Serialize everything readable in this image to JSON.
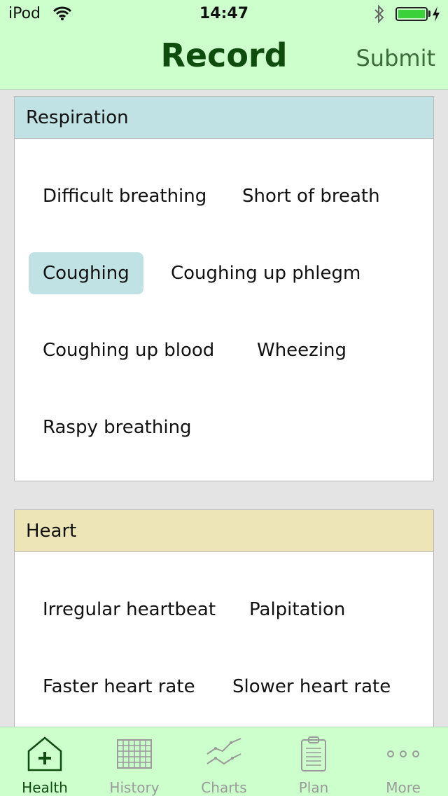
{
  "status": {
    "carrier": "iPod",
    "time": "14:47",
    "battery_level": 1.0
  },
  "nav": {
    "title": "Record",
    "submit_label": "Submit"
  },
  "sections": [
    {
      "title": "Respiration",
      "color": "#c1e2e4",
      "symptoms": [
        {
          "label": "Difficult breathing",
          "selected": false
        },
        {
          "label": "Short of breath",
          "selected": false
        },
        {
          "label": "Coughing",
          "selected": true
        },
        {
          "label": "Coughing up phlegm",
          "selected": false
        },
        {
          "label": "Coughing up blood",
          "selected": false
        },
        {
          "label": "Wheezing",
          "selected": false
        },
        {
          "label": "Raspy breathing",
          "selected": false
        }
      ]
    },
    {
      "title": "Heart",
      "color": "#ede5b8",
      "symptoms": [
        {
          "label": "Irregular heartbeat",
          "selected": false
        },
        {
          "label": "Palpitation",
          "selected": false
        },
        {
          "label": "Faster heart rate",
          "selected": false
        },
        {
          "label": "Slower heart rate",
          "selected": false
        }
      ]
    }
  ],
  "tabs": [
    {
      "label": "Health",
      "icon": "house-plus-icon",
      "active": true
    },
    {
      "label": "History",
      "icon": "grid-icon",
      "active": false
    },
    {
      "label": "Charts",
      "icon": "chart-lines-icon",
      "active": false
    },
    {
      "label": "Plan",
      "icon": "clipboard-icon",
      "active": false
    },
    {
      "label": "More",
      "icon": "more-dots-icon",
      "active": false
    }
  ],
  "colors": {
    "bar_background": "#ccffcc",
    "title_color": "#0f4d0f",
    "selected_symptom": "#c1e2e4"
  }
}
